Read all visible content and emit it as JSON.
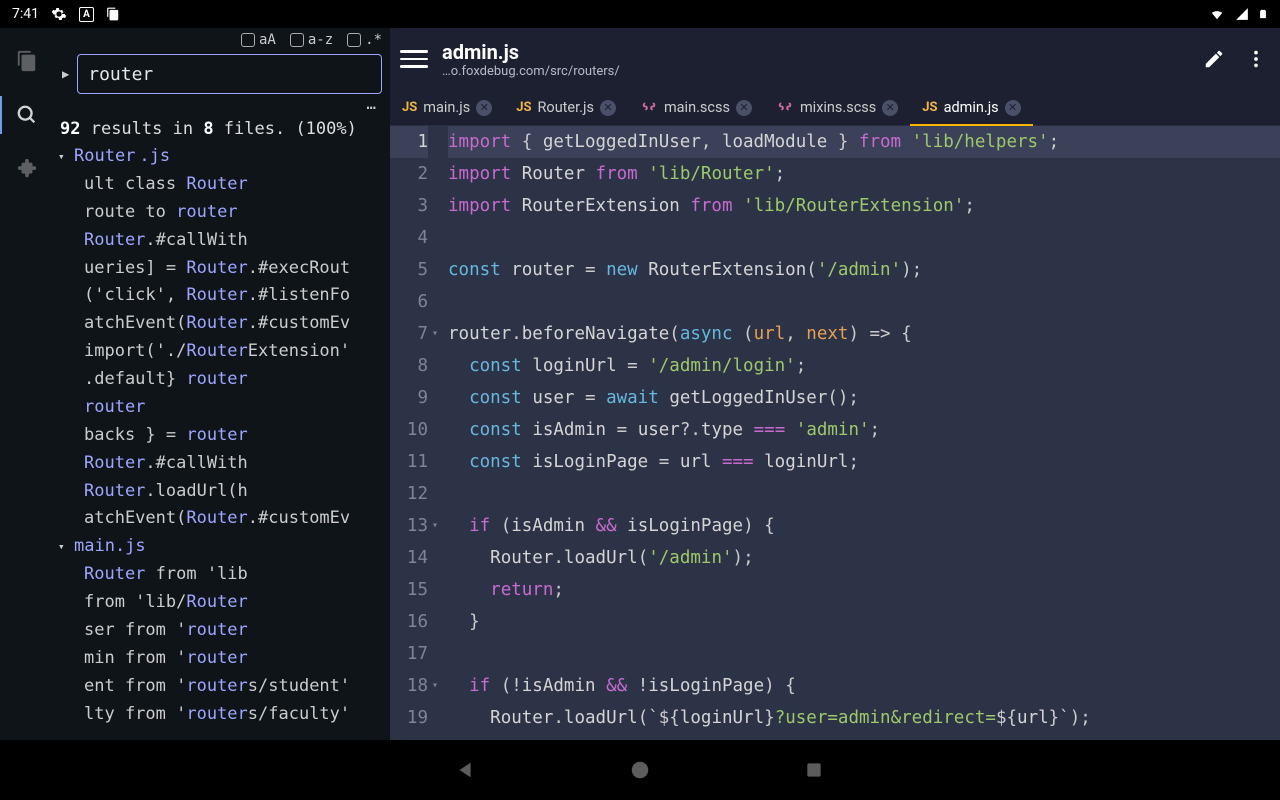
{
  "status": {
    "time": "7:41",
    "icons_left": [
      "gear",
      "language",
      "clipboard"
    ],
    "icons_right": [
      "wifi",
      "signal",
      "battery"
    ]
  },
  "search": {
    "controls": {
      "aA": "aA",
      "az": "a-z",
      "regex": ".*"
    },
    "query": "router",
    "more": "…",
    "summary_count": "92",
    "summary_text1": " results in ",
    "summary_files": "8",
    "summary_text2": " files. (100%)"
  },
  "tree": {
    "files": [
      {
        "name": "Router.js",
        "hlname": "Router",
        "suffix": ".js",
        "matches": [
          {
            "pre": "ult class ",
            "hl": "Router",
            "post": ""
          },
          {
            "pre": "route to ",
            "hl": "router",
            "post": ""
          },
          {
            "pre": "",
            "hl": "Router",
            "post": ".#callWith"
          },
          {
            "pre": "ueries] = ",
            "hl": "Router",
            "post": ".#execRout"
          },
          {
            "pre": "('click', ",
            "hl": "Router",
            "post": ".#listenFo"
          },
          {
            "pre": "atchEvent(",
            "hl": "Router",
            "post": ".#customEv"
          },
          {
            "pre": "import('./",
            "hl": "Router",
            "post": "Extension'"
          },
          {
            "pre": ".default} ",
            "hl": "router",
            "post": ""
          },
          {
            "pre": "",
            "hl": "router",
            "post": ""
          },
          {
            "pre": "backs } = ",
            "hl": "router",
            "post": ""
          },
          {
            "pre": "",
            "hl": "Router",
            "post": ".#callWith"
          },
          {
            "pre": "",
            "hl": "Router",
            "post": ".loadUrl(h"
          },
          {
            "pre": "atchEvent(",
            "hl": "Router",
            "post": ".#customEv"
          }
        ]
      },
      {
        "name": "main.js",
        "hlname": "",
        "suffix": "main.js",
        "matches": [
          {
            "pre": "",
            "hl": "Router",
            "post": " from 'lib"
          },
          {
            "pre": "from 'lib/",
            "hl": "Router",
            "post": ""
          },
          {
            "pre": "ser from '",
            "hl": "router",
            "post": ""
          },
          {
            "pre": "min from '",
            "hl": "router",
            "post": ""
          },
          {
            "pre": "ent from '",
            "hl": "router",
            "post": "s/student'"
          },
          {
            "pre": "lty from '",
            "hl": "router",
            "post": "s/faculty'"
          }
        ]
      }
    ]
  },
  "header": {
    "title": "admin.js",
    "path": "…o.foxdebug.com/src/routers/"
  },
  "tabs": [
    {
      "icon": "js",
      "label": "main.js",
      "active": false
    },
    {
      "icon": "js",
      "label": "Router.js",
      "active": false
    },
    {
      "icon": "scss",
      "label": "main.scss",
      "active": false
    },
    {
      "icon": "scss",
      "label": "mixins.scss",
      "active": false
    },
    {
      "icon": "js",
      "label": "admin.js",
      "active": true
    }
  ],
  "code": [
    {
      "n": 1,
      "active": true,
      "fold": "",
      "tokens": [
        [
          "kw",
          "import"
        ],
        [
          "op",
          " { "
        ],
        [
          "fn",
          "getLoggedInUser"
        ],
        [
          "op",
          ", "
        ],
        [
          "fn",
          "loadModule"
        ],
        [
          "op",
          " } "
        ],
        [
          "kw",
          "from"
        ],
        [
          "op",
          " "
        ],
        [
          "str",
          "'lib/helpers'"
        ],
        [
          "op",
          ";"
        ]
      ]
    },
    {
      "n": 2,
      "tokens": [
        [
          "kw",
          "import"
        ],
        [
          "op",
          " "
        ],
        [
          "var",
          "Router"
        ],
        [
          "op",
          " "
        ],
        [
          "kw",
          "from"
        ],
        [
          "op",
          " "
        ],
        [
          "str",
          "'lib/Router'"
        ],
        [
          "op",
          ";"
        ]
      ]
    },
    {
      "n": 3,
      "tokens": [
        [
          "kw",
          "import"
        ],
        [
          "op",
          " "
        ],
        [
          "var",
          "RouterExtension"
        ],
        [
          "op",
          " "
        ],
        [
          "kw",
          "from"
        ],
        [
          "op",
          " "
        ],
        [
          "str",
          "'lib/RouterExtension'"
        ],
        [
          "op",
          ";"
        ]
      ]
    },
    {
      "n": 4,
      "tokens": []
    },
    {
      "n": 5,
      "tokens": [
        [
          "ekw",
          "const"
        ],
        [
          "op",
          " "
        ],
        [
          "var",
          "router"
        ],
        [
          "op",
          " = "
        ],
        [
          "ekw",
          "new"
        ],
        [
          "op",
          " "
        ],
        [
          "fn",
          "RouterExtension"
        ],
        [
          "op",
          "("
        ],
        [
          "str",
          "'/admin'"
        ],
        [
          "op",
          ");"
        ]
      ]
    },
    {
      "n": 6,
      "tokens": []
    },
    {
      "n": 7,
      "fold": "▾",
      "tokens": [
        [
          "var",
          "router"
        ],
        [
          "op",
          "."
        ],
        [
          "fn",
          "beforeNavigate"
        ],
        [
          "op",
          "("
        ],
        [
          "ekw",
          "async"
        ],
        [
          "op",
          " ("
        ],
        [
          "lit",
          "url"
        ],
        [
          "op",
          ", "
        ],
        [
          "lit",
          "next"
        ],
        [
          "op",
          ") => {"
        ]
      ]
    },
    {
      "n": 8,
      "tokens": [
        [
          "op",
          "  "
        ],
        [
          "ekw",
          "const"
        ],
        [
          "op",
          " "
        ],
        [
          "var",
          "loginUrl"
        ],
        [
          "op",
          " = "
        ],
        [
          "str",
          "'/admin/login'"
        ],
        [
          "op",
          ";"
        ]
      ]
    },
    {
      "n": 9,
      "tokens": [
        [
          "op",
          "  "
        ],
        [
          "ekw",
          "const"
        ],
        [
          "op",
          " "
        ],
        [
          "var",
          "user"
        ],
        [
          "op",
          " = "
        ],
        [
          "ekw",
          "await"
        ],
        [
          "op",
          " "
        ],
        [
          "fn",
          "getLoggedInUser"
        ],
        [
          "op",
          "();"
        ]
      ]
    },
    {
      "n": 10,
      "tokens": [
        [
          "op",
          "  "
        ],
        [
          "ekw",
          "const"
        ],
        [
          "op",
          " "
        ],
        [
          "var",
          "isAdmin"
        ],
        [
          "op",
          " = "
        ],
        [
          "var",
          "user"
        ],
        [
          "op",
          "?."
        ],
        [
          "var",
          "type"
        ],
        [
          "op",
          " "
        ],
        [
          "kw",
          "==="
        ],
        [
          "op",
          " "
        ],
        [
          "str",
          "'admin'"
        ],
        [
          "op",
          ";"
        ]
      ]
    },
    {
      "n": 11,
      "tokens": [
        [
          "op",
          "  "
        ],
        [
          "ekw",
          "const"
        ],
        [
          "op",
          " "
        ],
        [
          "var",
          "isLoginPage"
        ],
        [
          "op",
          " = "
        ],
        [
          "var",
          "url"
        ],
        [
          "op",
          " "
        ],
        [
          "kw",
          "==="
        ],
        [
          "op",
          " "
        ],
        [
          "var",
          "loginUrl"
        ],
        [
          "op",
          ";"
        ]
      ]
    },
    {
      "n": 12,
      "tokens": []
    },
    {
      "n": 13,
      "fold": "▾",
      "tokens": [
        [
          "op",
          "  "
        ],
        [
          "kw",
          "if"
        ],
        [
          "op",
          " ("
        ],
        [
          "var",
          "isAdmin"
        ],
        [
          "op",
          " "
        ],
        [
          "kw",
          "&&"
        ],
        [
          "op",
          " "
        ],
        [
          "var",
          "isLoginPage"
        ],
        [
          "op",
          ") {"
        ]
      ]
    },
    {
      "n": 14,
      "tokens": [
        [
          "op",
          "    "
        ],
        [
          "var",
          "Router"
        ],
        [
          "op",
          "."
        ],
        [
          "fn",
          "loadUrl"
        ],
        [
          "op",
          "("
        ],
        [
          "str",
          "'/admin'"
        ],
        [
          "op",
          ");"
        ]
      ]
    },
    {
      "n": 15,
      "tokens": [
        [
          "op",
          "    "
        ],
        [
          "kw",
          "return"
        ],
        [
          "op",
          ";"
        ]
      ]
    },
    {
      "n": 16,
      "tokens": [
        [
          "op",
          "  }"
        ]
      ]
    },
    {
      "n": 17,
      "tokens": []
    },
    {
      "n": 18,
      "fold": "▾",
      "tokens": [
        [
          "op",
          "  "
        ],
        [
          "kw",
          "if"
        ],
        [
          "op",
          " (!"
        ],
        [
          "var",
          "isAdmin"
        ],
        [
          "op",
          " "
        ],
        [
          "kw",
          "&&"
        ],
        [
          "op",
          " !"
        ],
        [
          "var",
          "isLoginPage"
        ],
        [
          "op",
          ") {"
        ]
      ]
    },
    {
      "n": 19,
      "tokens": [
        [
          "op",
          "    "
        ],
        [
          "var",
          "Router"
        ],
        [
          "op",
          "."
        ],
        [
          "fn",
          "loadUrl"
        ],
        [
          "op",
          "(`${"
        ],
        [
          "var",
          "loginUrl"
        ],
        [
          "op",
          "}"
        ],
        [
          "str",
          "?user=admin&redirect="
        ],
        [
          "op",
          "${"
        ],
        [
          "var",
          "url"
        ],
        [
          "op",
          "}`);"
        ]
      ]
    }
  ]
}
